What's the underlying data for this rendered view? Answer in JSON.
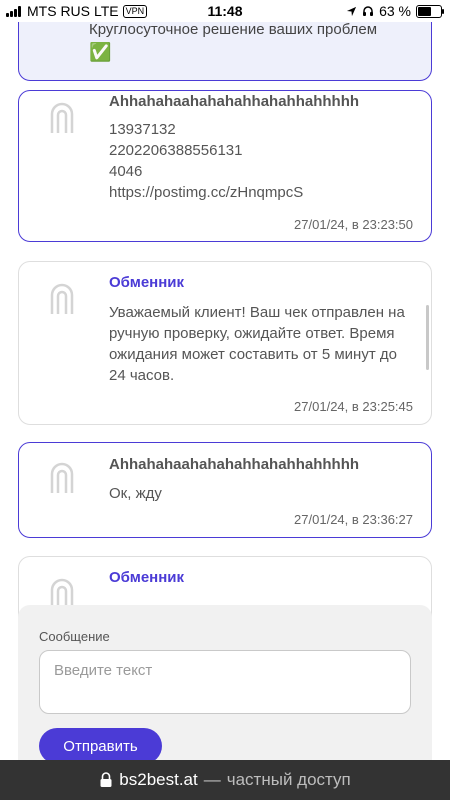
{
  "status_bar": {
    "carrier": "MTS RUS",
    "network": "LTE",
    "vpn": "VPN",
    "time": "11:48",
    "battery": "63 %",
    "battery_level": 0.63
  },
  "info_banner": {
    "text": "Круглосуточное решение ваших проблем",
    "check": "✅"
  },
  "messages": [
    {
      "author": "Аhhahahaahahahahhahahhahhhhh",
      "text": "13937132\n2202206388556131\n4046\nhttps://postimg.cc/zHnqmpcS",
      "time": "27/01/24, в 23:23:50"
    },
    {
      "author": "Обменник",
      "text": "Уважаемый клиент! Ваш чек отправлен на ручную проверку, ожидайте ответ. Время ожидания может составить от 5 минут до 24 часов.",
      "time": "27/01/24, в 23:25:45"
    },
    {
      "author": "Аhhahahaahahahahhahahhahhhhh",
      "text": "Ок, жду",
      "time": "27/01/24, в 23:36:27"
    },
    {
      "author": "Обменник",
      "text": "",
      "time": ""
    }
  ],
  "composer": {
    "label": "Сообщение",
    "placeholder": "Введите текст",
    "send_label": "Отправить"
  },
  "browser": {
    "domain": "bs2best.at",
    "separator": "—",
    "note": "частный доступ"
  },
  "colors": {
    "accent": "#4b3bd6",
    "banner_bg": "#eef0fb",
    "url_bar_bg": "#333333"
  }
}
